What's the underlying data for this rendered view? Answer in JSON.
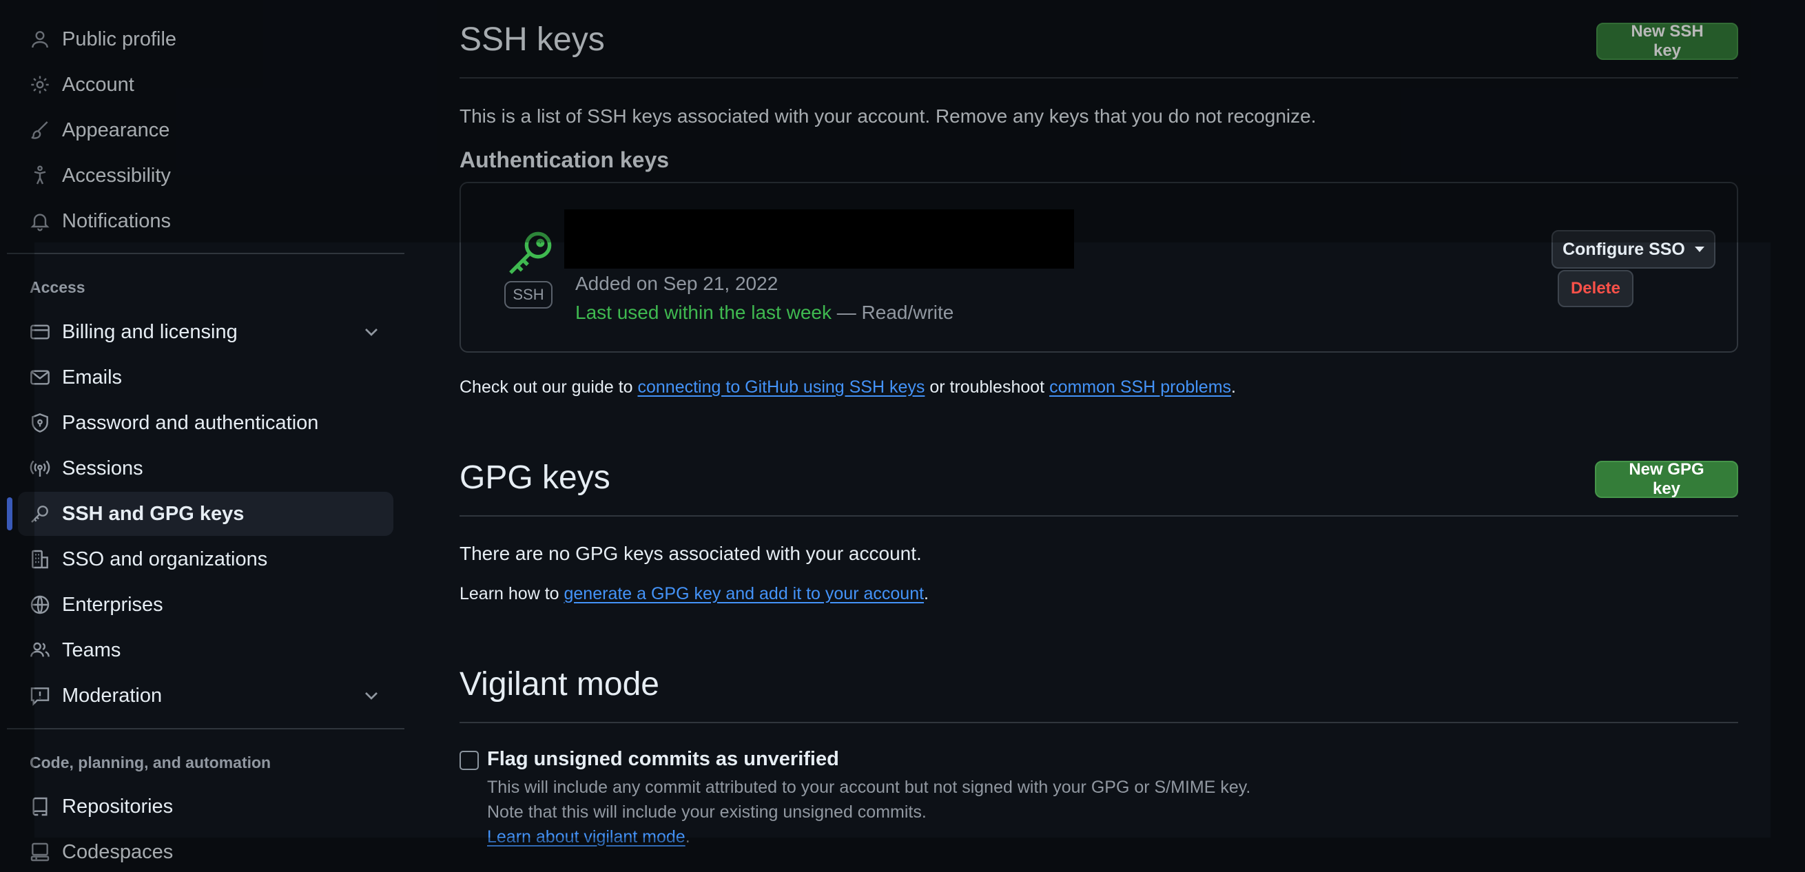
{
  "sidebar": {
    "items_top": [
      {
        "label": "Public profile",
        "icon": "person-icon"
      },
      {
        "label": "Account",
        "icon": "gear-icon"
      },
      {
        "label": "Appearance",
        "icon": "paintbrush-icon"
      },
      {
        "label": "Accessibility",
        "icon": "accessibility-icon"
      },
      {
        "label": "Notifications",
        "icon": "bell-icon"
      }
    ],
    "section_access": "Access",
    "items_access": [
      {
        "label": "Billing and licensing",
        "icon": "credit-card-icon"
      },
      {
        "label": "Emails",
        "icon": "mail-icon"
      },
      {
        "label": "Password and authentication",
        "icon": "shield-lock-icon"
      },
      {
        "label": "Sessions",
        "icon": "broadcast-icon"
      },
      {
        "label": "SSH and GPG keys",
        "icon": "key-icon"
      },
      {
        "label": "SSO and organizations",
        "icon": "organization-icon"
      },
      {
        "label": "Enterprises",
        "icon": "globe-icon"
      },
      {
        "label": "Teams",
        "icon": "people-icon"
      },
      {
        "label": "Moderation",
        "icon": "report-icon"
      }
    ],
    "section_code": "Code, planning, and automation",
    "items_code": [
      {
        "label": "Repositories",
        "icon": "repo-icon"
      },
      {
        "label": "Codespaces",
        "icon": "codespaces-icon"
      }
    ]
  },
  "ssh": {
    "title": "SSH keys",
    "new_button": "New SSH key",
    "description": "This is a list of SSH keys associated with your account. Remove any keys that you do not recognize.",
    "auth_heading": "Authentication keys",
    "key": {
      "badge": "SSH",
      "added": "Added on Sep 21, 2022",
      "last_used": "Last used within the last week",
      "access": " — Read/write",
      "configure_sso": "Configure SSO",
      "delete": "Delete"
    },
    "guide_prefix": "Check out our guide to ",
    "guide_link1": "connecting to GitHub using SSH keys",
    "guide_middle": " or troubleshoot ",
    "guide_link2": "common SSH problems",
    "guide_suffix": "."
  },
  "gpg": {
    "title": "GPG keys",
    "new_button": "New GPG key",
    "empty": "There are no GPG keys associated with your account.",
    "learn_prefix": "Learn how to ",
    "learn_link": "generate a GPG key and add it to your account",
    "learn_suffix": "."
  },
  "vigilant": {
    "title": "Vigilant mode",
    "checkbox_label": "Flag unsigned commits as unverified",
    "desc1": "This will include any commit attributed to your account but not signed with your GPG or S/MIME key.",
    "desc2": "Note that this will include your existing unsigned commits.",
    "learn_link": "Learn about vigilant mode",
    "learn_suffix": "."
  },
  "colors": {
    "background": "#0d1117",
    "primary_button": "#347d39",
    "link": "#4493f8",
    "success": "#3fb950",
    "danger": "#f85149",
    "active_indicator": "#4f7cff"
  }
}
